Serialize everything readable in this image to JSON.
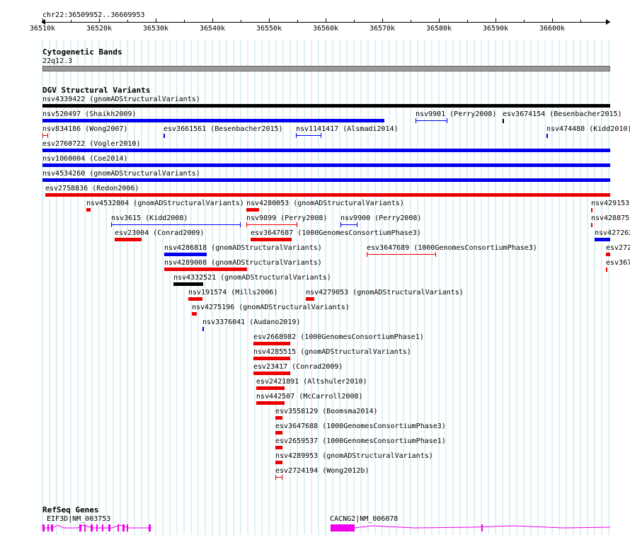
{
  "ruler": {
    "position": "chr22:36509952..36609953",
    "ticks": [
      "36510k",
      "36520k",
      "36530k",
      "36540k",
      "36550k",
      "36560k",
      "36570k",
      "36580k",
      "36590k",
      "36600k"
    ]
  },
  "colors": {
    "gain": "#0000ee",
    "loss": "#ee0000",
    "complex": "#000000",
    "gene": "#ee00ee",
    "grid": "#bfe3ea",
    "band": "#999999"
  },
  "cytobands": {
    "title": "Cytogenetic Bands",
    "band": "22q12.3"
  },
  "dgv": {
    "title": "DGV Structural Variants",
    "items": [
      {
        "label": "nsv4339422 (gnomADStructuralVariants)",
        "color": "complex"
      },
      {
        "label": "nsv520497 (Shaikh2009)",
        "color": "gain"
      },
      {
        "label": "nsv9901 (Perry2008)",
        "color": "gain"
      },
      {
        "label": "esv3674154 (Besenbacher2015)",
        "color": "complex"
      },
      {
        "label": "nsv834186 (Wong2007)",
        "color": "loss"
      },
      {
        "label": "esv3661561 (Besenbacher2015)",
        "color": "gain"
      },
      {
        "label": "nsv1141417 (Alsmadi2014)",
        "color": "gain"
      },
      {
        "label": "nsv474488 (Kidd2010)",
        "color": "gain"
      },
      {
        "label": "esv2760722 (Vogler2010)",
        "color": "gain"
      },
      {
        "label": "nsv1060004 (Coe2014)",
        "color": "gain"
      },
      {
        "label": "nsv4534260 (gnomADStructuralVariants)",
        "color": "gain"
      },
      {
        "label": "esv2758836 (Redon2006)",
        "color": "loss"
      },
      {
        "label": "nsv4532804 (gnomADStructuralVariants)",
        "color": "loss"
      },
      {
        "label": "nsv4280053 (gnomADStructuralVariants)",
        "color": "loss"
      },
      {
        "label": "nsv429153",
        "color": "loss"
      },
      {
        "label": "nsv3615 (Kidd2008)",
        "color": "gain"
      },
      {
        "label": "nsv9899 (Perry2008)",
        "color": "loss"
      },
      {
        "label": "nsv9900 (Perry2008)",
        "color": "gain"
      },
      {
        "label": "nsv428875",
        "color": "loss"
      },
      {
        "label": "esv23004 (Conrad2009)",
        "color": "loss"
      },
      {
        "label": "esv3647687 (1000GenomesConsortiumPhase3)",
        "color": "loss"
      },
      {
        "label": "nsv427262",
        "color": "gain"
      },
      {
        "label": "nsv4286818 (gnomADStructuralVariants)",
        "color": "gain"
      },
      {
        "label": "esv3647689 (1000GenomesConsortiumPhase3)",
        "color": "loss"
      },
      {
        "label": "esv272",
        "color": "loss"
      },
      {
        "label": "nsv4289008 (gnomADStructuralVariants)",
        "color": "loss"
      },
      {
        "label": "esv367",
        "color": "loss"
      },
      {
        "label": "nsv4332521 (gnomADStructuralVariants)",
        "color": "complex"
      },
      {
        "label": "nsv191574 (Mills2006)",
        "color": "loss"
      },
      {
        "label": "nsv4279053 (gnomADStructuralVariants)",
        "color": "loss"
      },
      {
        "label": "nsv4275196 (gnomADStructuralVariants)",
        "color": "loss"
      },
      {
        "label": "nsv3376041 (Audano2019)",
        "color": "gain"
      },
      {
        "label": "esv2668982 (1000GenomesConsortiumPhase1)",
        "color": "loss"
      },
      {
        "label": "nsv4285515 (gnomADStructuralVariants)",
        "color": "loss"
      },
      {
        "label": "esv23417 (Conrad2009)",
        "color": "loss"
      },
      {
        "label": "esv2421891 (Altshuler2010)",
        "color": "loss"
      },
      {
        "label": "nsv442507 (McCarroll2008)",
        "color": "loss"
      },
      {
        "label": "esv3558129 (Boomsma2014)",
        "color": "loss"
      },
      {
        "label": "esv3647688 (1000GenomesConsortiumPhase3)",
        "color": "loss"
      },
      {
        "label": "esv2659537 (1000GenomesConsortiumPhase1)",
        "color": "loss"
      },
      {
        "label": "nsv4289953 (gnomADStructuralVariants)",
        "color": "loss"
      },
      {
        "label": "esv2724194 (Wong2012b)",
        "color": "loss"
      }
    ]
  },
  "refseq": {
    "title": "RefSeq Genes",
    "genes": [
      {
        "label": "EIF3D|NM_003753"
      },
      {
        "label": "CACNG2|NM_006078"
      }
    ]
  }
}
